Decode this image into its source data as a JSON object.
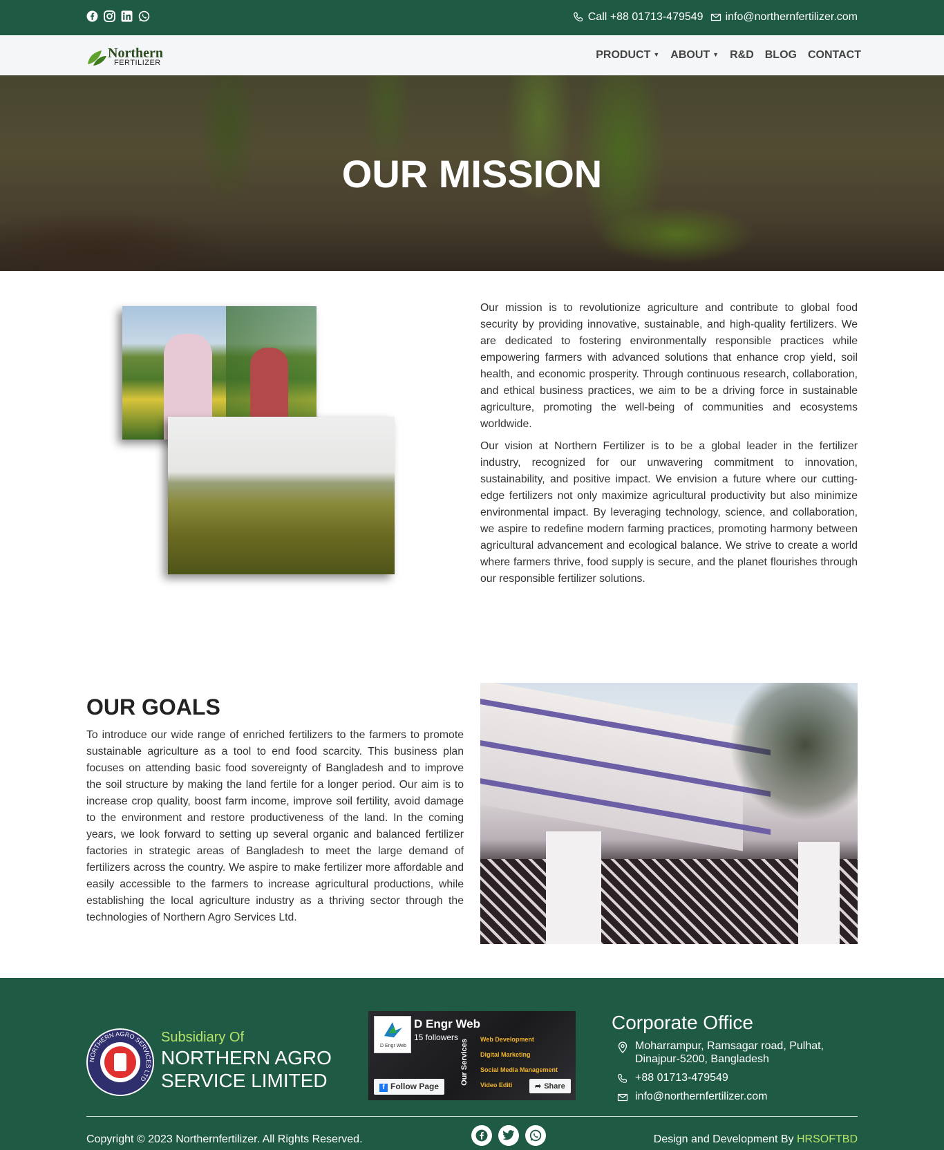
{
  "topbar": {
    "social_icons": [
      "facebook-icon",
      "instagram-icon",
      "linkedin-icon",
      "whatsapp-icon"
    ],
    "phone": "Call +88 01713-479549",
    "email": "info@northernfertilizer.com"
  },
  "navbar": {
    "logo_line1": "Northern",
    "logo_line2": "FERTILIZER",
    "items": [
      {
        "label": "PRODUCT",
        "has_caret": true
      },
      {
        "label": "ABOUT",
        "has_caret": true
      },
      {
        "label": "R&D",
        "has_caret": false
      },
      {
        "label": "BLOG",
        "has_caret": false
      },
      {
        "label": "CONTACT",
        "has_caret": false
      }
    ]
  },
  "hero": {
    "title": "OUR MISSION"
  },
  "mission": {
    "paragraph1": "Our mission is to revolutionize agriculture and contribute to global food security by providing innovative, sustainable, and high-quality fertilizers. We are dedicated to fostering environmentally responsible practices while empowering farmers with advanced solutions that enhance crop yield, soil health, and economic prosperity. Through continuous research, collaboration, and ethical business practices, we aim to be a driving force in sustainable agriculture, promoting the well-being of communities and ecosystems worldwide.",
    "paragraph2": "Our vision at Northern Fertilizer is to be a global leader in the fertilizer industry, recognized for our unwavering commitment to innovation, sustainability, and positive impact. We envision a future where our cutting-edge fertilizers not only maximize agricultural productivity but also minimize environmental impact. By leveraging technology, science, and collaboration, we aspire to redefine modern farming practices, promoting harmony between agricultural advancement and ecological balance. We strive to create a world where farmers thrive, food supply is secure, and the planet flourishes through our responsible fertilizer solutions."
  },
  "goals": {
    "title": "OUR GOALS",
    "text": "To introduce our wide range of enriched fertilizers to the farmers to promote sustainable agriculture as a tool to end food scarcity. This business plan focuses on attending basic food sovereignty of Bangladesh and to improve the soil structure by making the land fertile for a longer period. Our aim is to increase crop quality, boost farm income, improve soil fertility, avoid damage to the environment and restore productiveness of the land. In the coming years, we look forward to setting up several organic and balanced fertilizer factories in strategic areas of Bangladesh to meet the large demand of fertilizers across the country. We aspire to make fertilizer more affordable and easily accessible to the farmers to increase agricultural productions, while establishing the local agriculture industry as a thriving sector through the technologies of Northern Agro Services Ltd."
  },
  "footer": {
    "subsidiary_label": "Subsidiary Of",
    "company_line1": "NORTHERN AGRO",
    "company_line2": "SERVICE LIMITED",
    "seal_text": "NORTHERN AGRO SERVICES LTD",
    "fb_widget": {
      "page_name": "D Engr Web",
      "followers": "15 followers",
      "thumb_label": "D Engr Web",
      "vertical_text": "Our Services",
      "services": [
        "Web Development",
        "Digital Marketing",
        "Social Media Management",
        "Video Editi"
      ],
      "follow_label": "Follow Page",
      "share_label": "Share"
    },
    "corporate_title": "Corporate Office",
    "address_line1": "Moharrampur, Ramsagar road, Pulhat,",
    "address_line2": "Dinajpur-5200, Bangladesh",
    "phone": "+88 01713-479549",
    "email": "info@northernfertilizer.com",
    "copyright": "Copyright © 2023 Northernfertilizer. All Rights Reserved.",
    "social_icons": [
      "facebook-icon",
      "twitter-icon",
      "whatsapp-icon"
    ],
    "design_prefix": "Design and Development By ",
    "design_brand": "HRSOFTBD"
  },
  "colors": {
    "primary_green": "#1f5a45",
    "accent_lime": "#b6e36a",
    "navbar_bg": "#f5f6f7"
  }
}
